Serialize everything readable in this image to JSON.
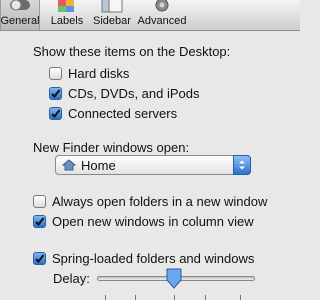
{
  "toolbar": {
    "items": [
      {
        "label": "General",
        "icon": "general-switch-icon",
        "selected": true
      },
      {
        "label": "Labels",
        "icon": "labels-icon",
        "selected": false
      },
      {
        "label": "Sidebar",
        "icon": "sidebar-icon",
        "selected": false
      },
      {
        "label": "Advanced",
        "icon": "advanced-gear-icon",
        "selected": false
      }
    ]
  },
  "desktop": {
    "heading": "Show these items on the Desktop:",
    "items": [
      {
        "label": "Hard disks",
        "checked": false
      },
      {
        "label": "CDs, DVDs, and iPods",
        "checked": true
      },
      {
        "label": "Connected servers",
        "checked": true
      }
    ]
  },
  "new_window": {
    "heading": "New Finder windows open:",
    "selected": "Home"
  },
  "options": [
    {
      "label": "Always open folders in a new window",
      "checked": false
    },
    {
      "label": "Open new windows in column view",
      "checked": true
    }
  ],
  "spring": {
    "label": "Spring-loaded folders and windows",
    "checked": true,
    "delay_label": "Delay:",
    "delay_level": 0.5
  },
  "colors": {
    "accent": "#2a6fc9",
    "toolbar_bg": "#d4d4d4",
    "window_bg": "#e8e8e8"
  }
}
